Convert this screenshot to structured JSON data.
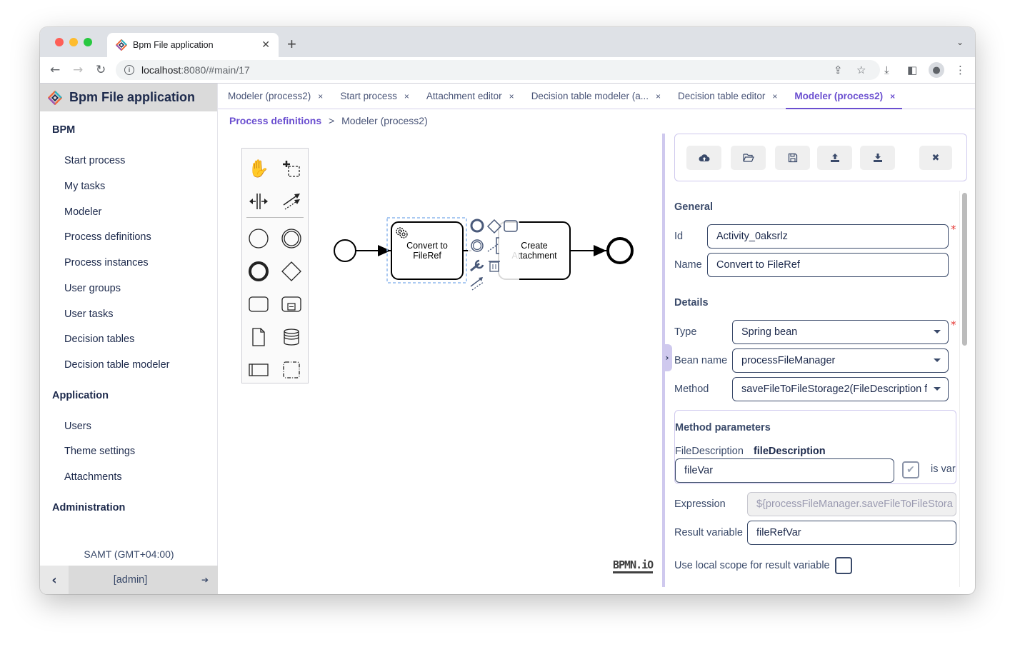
{
  "browser": {
    "tab_title": "Bpm File application",
    "new_tab_label": "+",
    "url_host": "localhost",
    "url_path": ":8080/#main/17",
    "icons": [
      "back-arrow-icon",
      "forward-arrow-icon",
      "reload-icon",
      "info-icon",
      "share-icon",
      "star-icon",
      "download-icon",
      "sidepanel-icon",
      "profile-icon",
      "kebab-menu-icon",
      "tab-list-chevron-icon"
    ]
  },
  "sidebar": {
    "app_title": "Bpm File application",
    "sections": [
      {
        "title": "BPM",
        "items": [
          "Start process",
          "My tasks",
          "Modeler",
          "Process definitions",
          "Process instances",
          "User groups",
          "User tasks",
          "Decision tables",
          "Decision table modeler"
        ]
      },
      {
        "title": "Application",
        "items": [
          "Users",
          "Theme settings",
          "Attachments"
        ]
      },
      {
        "title": "Administration",
        "items": []
      }
    ],
    "timezone": "SAMT (GMT+04:00)",
    "username": "[admin]"
  },
  "app_tabs": [
    {
      "label": "Modeler (process2)",
      "active": false
    },
    {
      "label": "Start process",
      "active": false
    },
    {
      "label": "Attachment editor",
      "active": false
    },
    {
      "label": "Decision table modeler (a...",
      "active": false
    },
    {
      "label": "Decision table editor",
      "active": false
    },
    {
      "label": "Modeler (process2)",
      "active": true
    }
  ],
  "tab_close_glyph": "×",
  "breadcrumb": {
    "link": "Process definitions",
    "separator": ">",
    "current": "Modeler (process2)"
  },
  "diagram": {
    "tasks": [
      {
        "label_line1": "Convert to",
        "label_line2": "FileRef",
        "type": "service-task",
        "selected": true
      },
      {
        "label_line1": "Create",
        "label_line2": "Attachment",
        "type": "task",
        "selected": false
      }
    ],
    "watermark": "BPMN.iO",
    "palette": [
      "hand-tool",
      "lasso-tool",
      "space-tool",
      "global-connect-tool",
      "start-event",
      "intermediate-event",
      "end-event",
      "gateway",
      "task",
      "subprocess",
      "data-object",
      "data-store",
      "pool",
      "group"
    ]
  },
  "properties": {
    "toolbar": [
      "cloud-upload-icon",
      "folder-open-icon",
      "save-icon",
      "upload-icon",
      "download-icon",
      "close-icon"
    ],
    "general_title": "General",
    "id_label": "Id",
    "id_value": "Activity_0aksrlz",
    "name_label": "Name",
    "name_value": "Convert to FileRef",
    "details_title": "Details",
    "type_label": "Type",
    "type_value": "Spring bean",
    "bean_label": "Bean name",
    "bean_value": "processFileManager",
    "method_label": "Method",
    "method_value": "saveFileToFileStorage2(FileDescription f",
    "params_title": "Method parameters",
    "param_type": "FileDescription",
    "param_name": "fileDescription",
    "param_value": "fileVar",
    "param_is_var_checked": true,
    "param_is_var_label": "is var",
    "expression_label": "Expression",
    "expression_value": "${processFileManager.saveFileToFileStora",
    "result_label": "Result variable",
    "result_value": "fileRefVar",
    "local_scope_label": "Use local scope for result variable",
    "local_scope_checked": false,
    "required_mark": "*"
  }
}
